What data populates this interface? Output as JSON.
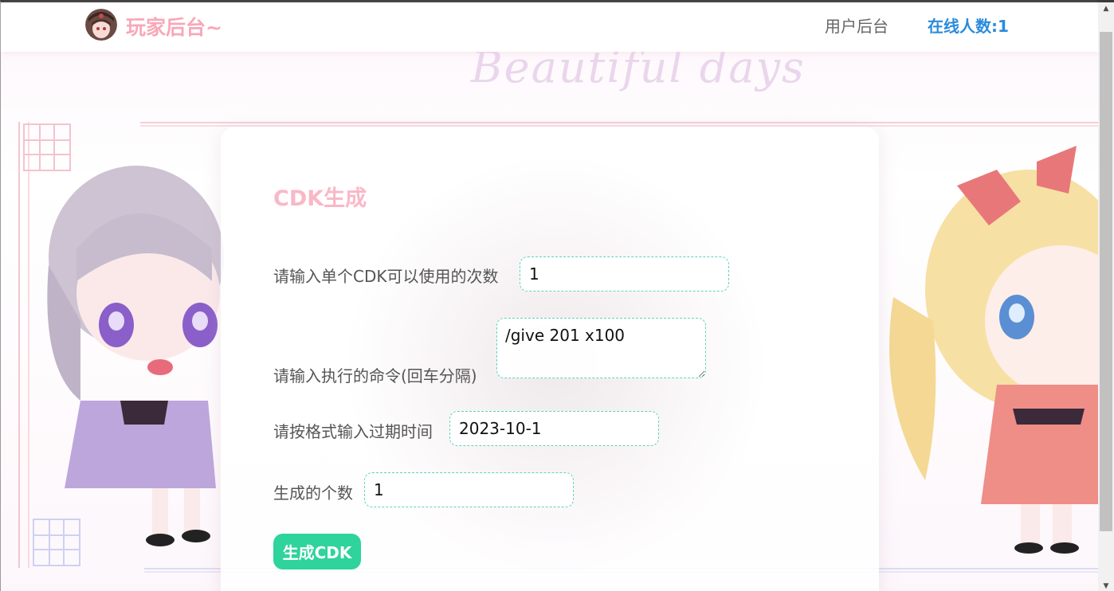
{
  "header": {
    "title": "玩家后台~",
    "nav_user": "用户后台",
    "nav_online": "在线人数:1"
  },
  "background": {
    "script_text": "Beautiful days"
  },
  "card": {
    "title": "CDK生成",
    "fields": [
      {
        "label": "请输入单个CDK可以使用的次数",
        "value": "1"
      },
      {
        "label": "请输入执行的命令(回车分隔)",
        "value": "/give 201 x100"
      },
      {
        "label": "请按格式输入过期时间",
        "value": "2023-10-1"
      },
      {
        "label": "生成的个数",
        "value": "1"
      }
    ],
    "button_label": "生成CDK"
  },
  "colors": {
    "title_pink": "#f7a8b8",
    "online_blue": "#2b8bdc",
    "button_green": "#2fd39c",
    "field_border": "#5fd3bf"
  }
}
